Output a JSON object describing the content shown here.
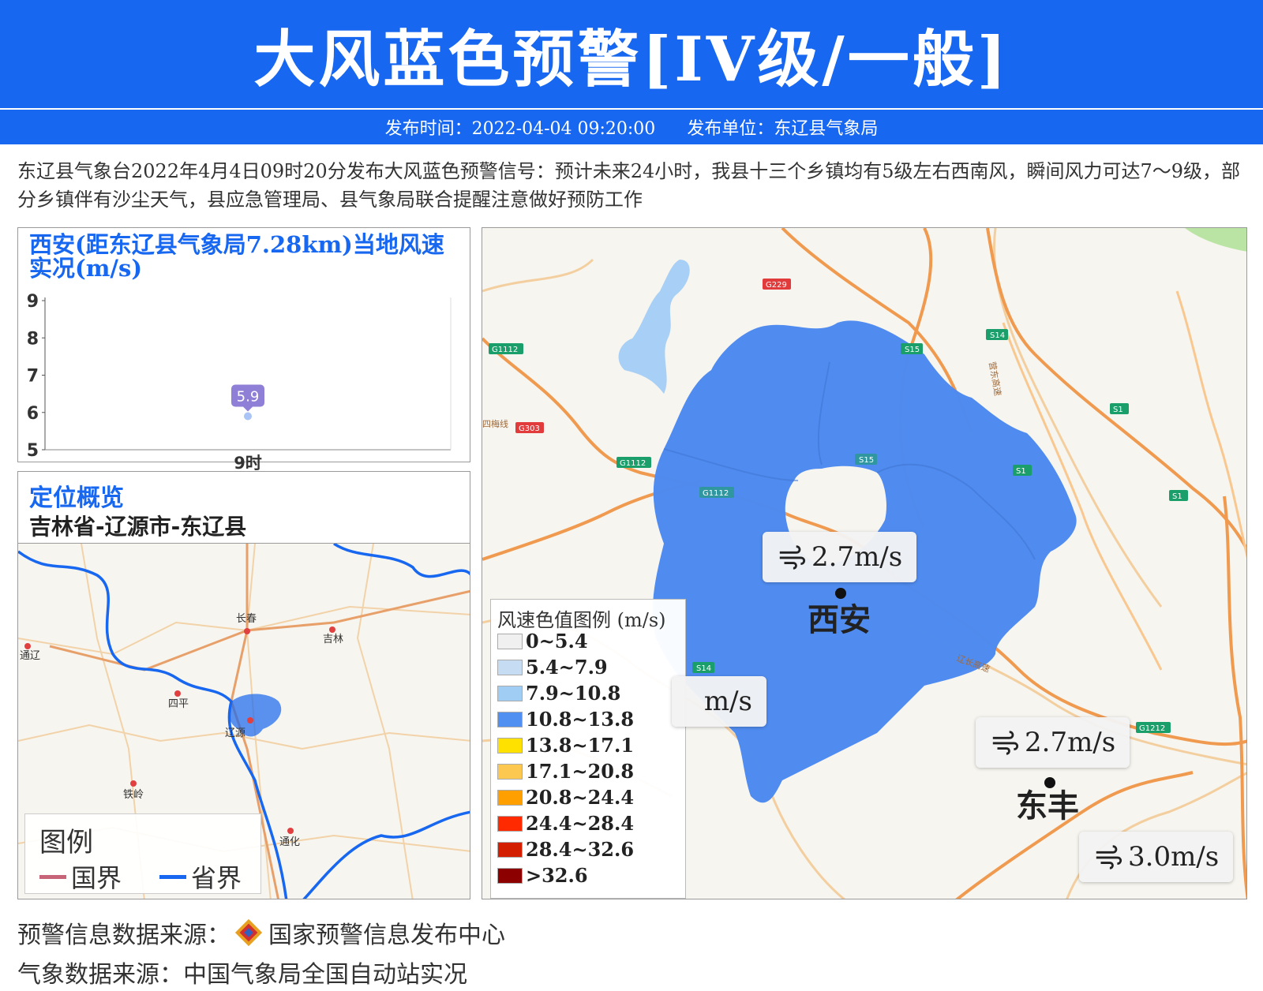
{
  "header": {
    "title": "大风蓝色预警[IV级/一般]",
    "publish_time": "发布时间：2022-04-04 09:20:00",
    "publisher": "发布单位：东辽县气象局",
    "color": "#1767f0"
  },
  "description": "东辽县气象台2022年4月4日09时20分发布大风蓝色预警信号：预计未来24小时，我县十三个乡镇均有5级左右西南风，瞬间风力可达7～9级，部分乡镇伴有沙尘天气，县应急管理局、县气象局联合提醒注意做好预防工作",
  "wind_chart": {
    "title": "西安(距东辽县气象局7.28km)当地风速实况(m/s)"
  },
  "chart_data": {
    "type": "line",
    "title": "西安(距东辽县气象局7.28km)当地风速实况(m/s)",
    "categories": [
      "9时"
    ],
    "values": [
      5.9
    ],
    "yticks": [
      5,
      6,
      7,
      8,
      9
    ],
    "ylim": [
      5,
      9
    ],
    "data_labels": [
      "5.9"
    ],
    "grid": false,
    "point_color": "#a9c4f5",
    "label_color": "#8f7fd6"
  },
  "location": {
    "title": "定位概览",
    "path": "吉林省-辽源市-东辽县",
    "cities": [
      "长春",
      "吉林",
      "通辽",
      "四平",
      "辽源",
      "铁岭",
      "通化"
    ],
    "legend": {
      "title": "图例",
      "national": "国界",
      "provincial": "省界",
      "national_color": "#c86478",
      "provincial_color": "#1767f0"
    }
  },
  "main_map": {
    "road_labels": [
      "G229",
      "G1112",
      "S15",
      "S14",
      "G303",
      "G1112",
      "G1112",
      "S15",
      "S1",
      "S1",
      "S1",
      "S14",
      "G1212",
      "四梅线",
      "营东高速",
      "辽长高速"
    ],
    "stations": [
      {
        "name": "西安",
        "speed": "2.7m/s"
      },
      {
        "name": "东丰",
        "speed": "2.7m/s"
      },
      {
        "name": "",
        "speed": "3.0m/s"
      },
      {
        "name": "",
        "speed": "m/s"
      }
    ],
    "warning_fill": "#4d8af0"
  },
  "scale": {
    "title": "风速色值图例 (m/s)",
    "items": [
      {
        "label": "0~5.4",
        "color": "#f0f0f0"
      },
      {
        "label": "5.4~7.9",
        "color": "#c6dcf2"
      },
      {
        "label": "7.9~10.8",
        "color": "#9fcdf4"
      },
      {
        "label": "10.8~13.8",
        "color": "#4f90f0"
      },
      {
        "label": "13.8~17.1",
        "color": "#ffe100"
      },
      {
        "label": "17.1~20.8",
        "color": "#fcc850"
      },
      {
        "label": "20.8~24.4",
        "color": "#ffa000"
      },
      {
        "label": "24.4~28.4",
        "color": "#ff2a00"
      },
      {
        "label": "28.4~32.6",
        "color": "#d41e00"
      },
      {
        "label": ">32.6",
        "color": "#8c0000"
      }
    ]
  },
  "footer": {
    "warning_source_label": "预警信息数据来源：",
    "warning_source": "国家预警信息发布中心",
    "weather_source": "气象数据来源：中国气象局全国自动站实况"
  }
}
